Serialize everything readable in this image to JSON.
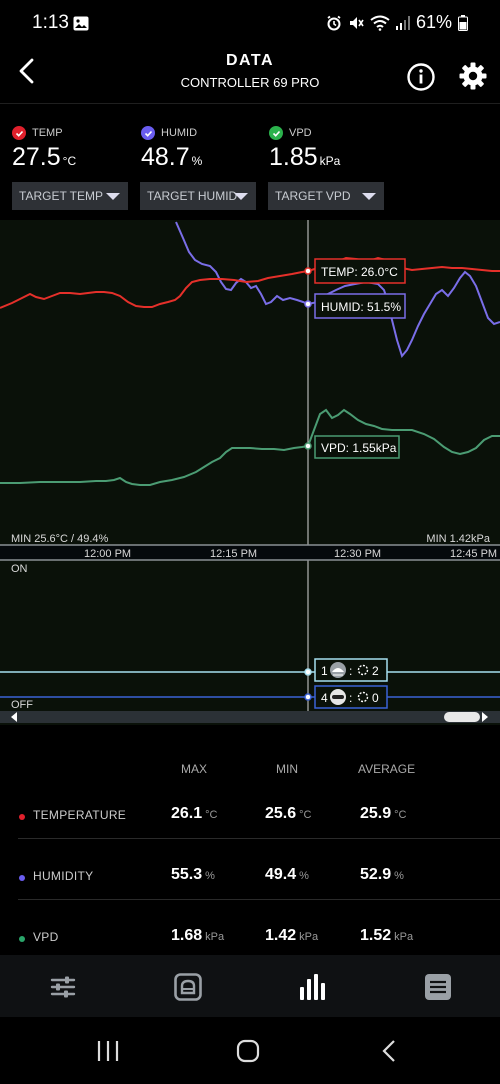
{
  "status": {
    "time": "1:13",
    "battery": "61%"
  },
  "header": {
    "title": "DATA",
    "subtitle": "CONTROLLER 69 PRO"
  },
  "readings": [
    {
      "label": "TEMP",
      "value": "27.5",
      "unit": "°C",
      "color": "#e0202c",
      "target": "TARGET TEMP"
    },
    {
      "label": "HUMID",
      "value": "48.7",
      "unit": "%",
      "color": "#6a5df0",
      "target": "TARGET HUMID"
    },
    {
      "label": "VPD",
      "value": "1.85",
      "unit": "kPa",
      "color": "#2bb24c",
      "target": "TARGET VPD"
    }
  ],
  "chart": {
    "tooltips": {
      "temp": "TEMP: 26.0°C",
      "humid": "HUMID: 51.5%",
      "vpd": "VPD: 1.55kPa"
    },
    "min_left": "MIN 25.6°C / 49.4%",
    "min_right": "MIN 1.42kPa",
    "time_ticks": [
      "12:00 PM",
      "12:15 PM",
      "12:30 PM",
      "12:45 PM"
    ],
    "on_label": "ON",
    "off_label": "OFF",
    "device_1": {
      "left": "1",
      "right": "2"
    },
    "device_2": {
      "left": "4",
      "right": "0"
    },
    "colors": {
      "temp": "#e5302a",
      "humid": "#7a6ee8",
      "vpd": "#4b9c73"
    }
  },
  "stats": {
    "headers": {
      "max": "MAX",
      "min": "MIN",
      "average": "AVERAGE"
    },
    "rows": [
      {
        "name": "TEMPERATURE",
        "color": "#e0202c",
        "max": "26.1",
        "min": "25.6",
        "avg": "25.9",
        "unit": "°C"
      },
      {
        "name": "HUMIDITY",
        "color": "#6a5df0",
        "max": "55.3",
        "min": "49.4",
        "avg": "52.9",
        "unit": "%"
      },
      {
        "name": "VPD",
        "color": "#2aa56a",
        "max": "1.68",
        "min": "1.42",
        "avg": "1.52",
        "unit": "kPa"
      }
    ]
  },
  "nav": {
    "items": [
      "sliders-icon",
      "device-icon",
      "bar-chart-icon",
      "list-icon"
    ]
  }
}
